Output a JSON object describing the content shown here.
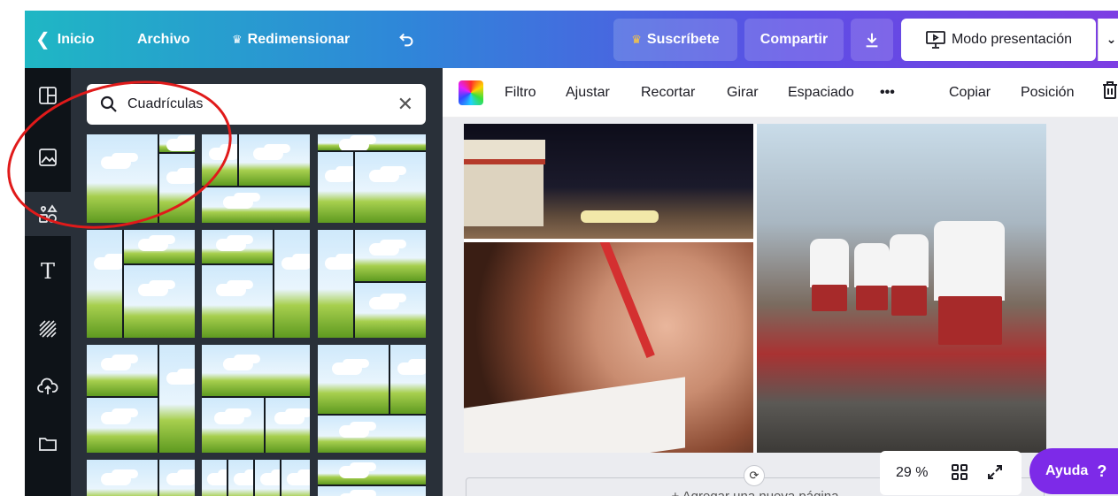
{
  "topbar": {
    "home": "Inicio",
    "file": "Archivo",
    "resize": "Redimensionar",
    "subscribe": "Suscríbete",
    "share": "Compartir",
    "presentation": "Modo presentación"
  },
  "search": {
    "value": "Cuadrículas"
  },
  "toolbar": {
    "filter": "Filtro",
    "adjust": "Ajustar",
    "crop": "Recortar",
    "rotate": "Girar",
    "spacing": "Espaciado",
    "more": "•••",
    "copy": "Copiar",
    "position": "Posición"
  },
  "bottom": {
    "add_page": "+ Agregar una nueva página",
    "zoom": "29 %",
    "help": "Ayuda",
    "help_icon": "?"
  },
  "colors": {
    "accent": "#7d2ae8",
    "panel": "#293039",
    "rail": "#0e1318",
    "annotation": "#e01a1a"
  },
  "icons": [
    "chevron-left-icon",
    "crown-icon",
    "undo-icon",
    "download-icon",
    "presentation-icon",
    "chevron-down-icon",
    "layout-icon",
    "photo-icon",
    "elements-icon",
    "text-icon",
    "background-icon",
    "upload-icon",
    "folder-icon",
    "search-icon",
    "close-icon",
    "color-picker-icon",
    "trash-icon",
    "grid-view-icon",
    "fullscreen-icon",
    "rotate-icon"
  ]
}
